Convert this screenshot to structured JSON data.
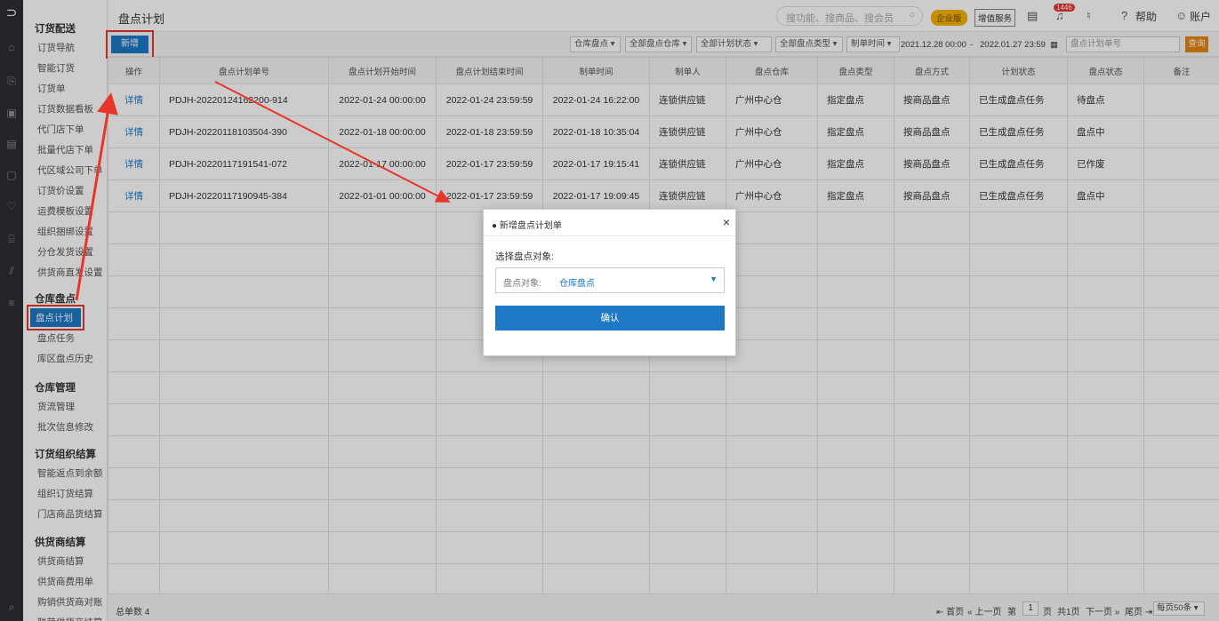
{
  "rail": {
    "icons": [
      "logo-icon",
      "home-icon",
      "order-icon",
      "inventory-icon",
      "report-icon",
      "settlement-icon",
      "promotion-icon",
      "warehouse-icon",
      "chart-icon",
      "menu-icon",
      "search-icon"
    ]
  },
  "sidebar": {
    "sections": [
      {
        "title": "订货配送",
        "items": [
          "订货导航",
          "智能订货",
          "订货单",
          "订货数据看板",
          "代门店下单",
          "批量代店下单",
          "代区域公司下单",
          "订货价设置",
          "运费模板设置",
          "组织捆绑设置",
          "分仓发货设置",
          "供货商直发设置"
        ]
      },
      {
        "title": "仓库盘点",
        "items": [
          "盘点计划",
          "盘点任务",
          "库区盘点历史"
        ]
      },
      {
        "title": "仓库管理",
        "items": [
          "货流管理",
          "批次信息修改"
        ]
      },
      {
        "title": "订货组织结算",
        "items": [
          "智能返点到余额",
          "组织订货结算",
          "门店商品货结算"
        ]
      },
      {
        "title": "供货商结算",
        "items": [
          "供货商结算",
          "供货商费用单",
          "购销供货商对账",
          "联营供货商结算"
        ]
      }
    ],
    "active_item": "盘点计划"
  },
  "header": {
    "title": "盘点计划",
    "search_placeholder": "搜功能、搜商品、搜会员",
    "enterprise_badge": "企业版",
    "vas_button": "增值服务",
    "notification_count": "1446",
    "help": "帮助",
    "account": "账户"
  },
  "toolbar": {
    "new_button": "新增",
    "filters": [
      "仓库盘点",
      "全部盘点仓库",
      "全部计划状态",
      "全部盘点类型",
      "制单时间"
    ],
    "date_from": "2021.12.28 00:00",
    "date_sep": "-",
    "date_to": "2022.01.27 23:59",
    "plan_no_placeholder": "盘点计划单号",
    "query_button": "查询"
  },
  "table": {
    "columns": [
      "操作",
      "盘点计划单号",
      "盘点计划开始时间",
      "盘点计划结束时间",
      "制单时间",
      "制单人",
      "盘点仓库",
      "盘点类型",
      "盘点方式",
      "计划状态",
      "盘点状态",
      "备注"
    ],
    "rows": [
      [
        "详情",
        "PDJH-20220124162200-914",
        "2022-01-24 00:00:00",
        "2022-01-24 23:59:59",
        "2022-01-24 16:22:00",
        "连锁供应链",
        "广州中心仓",
        "指定盘点",
        "按商品盘点",
        "已生成盘点任务",
        "待盘点",
        ""
      ],
      [
        "详情",
        "PDJH-20220118103504-390",
        "2022-01-18 00:00:00",
        "2022-01-18 23:59:59",
        "2022-01-18 10:35:04",
        "连锁供应链",
        "广州中心仓",
        "指定盘点",
        "按商品盘点",
        "已生成盘点任务",
        "盘点中",
        ""
      ],
      [
        "详情",
        "PDJH-20220117191541-072",
        "2022-01-17 00:00:00",
        "2022-01-17 23:59:59",
        "2022-01-17 19:15:41",
        "连锁供应链",
        "广州中心仓",
        "指定盘点",
        "按商品盘点",
        "已生成盘点任务",
        "已作废",
        ""
      ],
      [
        "详情",
        "PDJH-20220117190945-384",
        "2022-01-01 00:00:00",
        "2022-01-17 23:59:59",
        "2022-01-17 19:09:45",
        "连锁供应链",
        "广州中心仓",
        "指定盘点",
        "按商品盘点",
        "已生成盘点任务",
        "盘点中",
        ""
      ]
    ]
  },
  "footer": {
    "total": "总单数 4",
    "first": "首页",
    "prev": "上一页",
    "page_prefix": "第",
    "page": "1",
    "page_suffix": "页",
    "total_pages": "共1页",
    "next": "下一页",
    "last": "尾页",
    "page_size": "每页50条"
  },
  "modal": {
    "title": "新增盘点计划单",
    "label": "选择盘点对象:",
    "select_label": "盘点对象:",
    "select_value": "仓库盘点",
    "confirm": "确认"
  },
  "colors": {
    "primary": "#1d78c6",
    "query": "#e6860f",
    "highlight": "#e8352c",
    "enterprise": "#f5b400"
  }
}
